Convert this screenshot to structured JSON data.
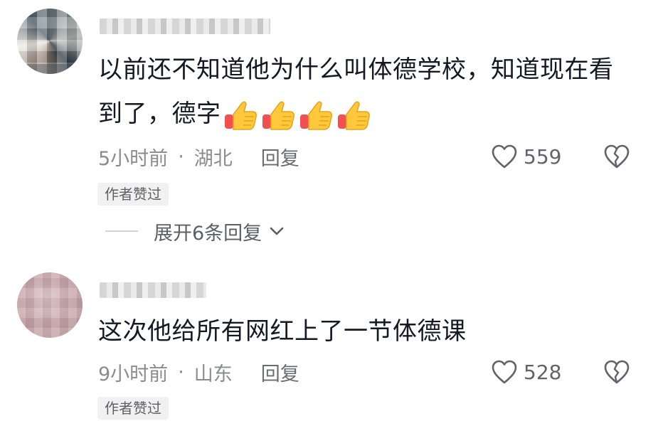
{
  "comments": [
    {
      "text_line1": "以前还不知道他为什么叫体德学校，知道现在看",
      "text_line2": "到了，德字",
      "emoji": [
        "thumbs-up",
        "thumbs-up",
        "thumbs-up",
        "thumbs-up"
      ],
      "time": "5小时前",
      "separator": "·",
      "location": "湖北",
      "reply_label": "回复",
      "likes": "559",
      "badge": "作者赞过",
      "expand_label": "展开6条回复"
    },
    {
      "text_line1": "这次他给所有网红上了一节体德课",
      "time": "9小时前",
      "separator": "·",
      "location": "山东",
      "reply_label": "回复",
      "likes": "528",
      "badge": "作者赞过"
    }
  ],
  "colors": {
    "text": "#161823",
    "meta": "#8a8b91",
    "badge_bg": "#f1f1f2",
    "thumb_yellow": "#ffc83d",
    "thumb_red": "#f25050"
  },
  "icons": [
    "heart-outline-icon",
    "broken-heart-icon",
    "chevron-down-icon",
    "thumbs-up-emoji"
  ]
}
